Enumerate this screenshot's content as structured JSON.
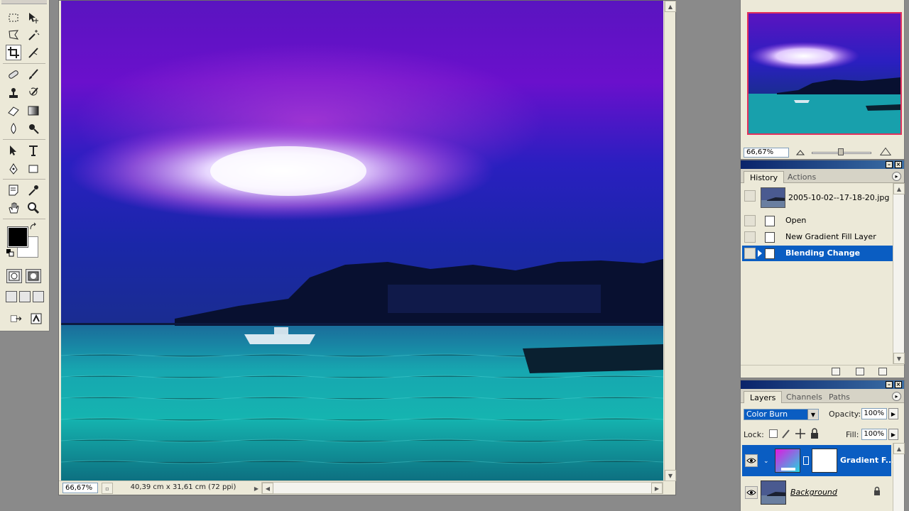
{
  "document": {
    "zoom": "66,67%",
    "info": "40,39 cm x 31,61 cm (72 ppi)"
  },
  "toolbox": {
    "tools": [
      "marquee-tool",
      "move-tool",
      "lasso-tool",
      "magic-wand-tool",
      "crop-tool",
      "slice-tool",
      "healing-brush-tool",
      "brush-tool",
      "clone-stamp-tool",
      "history-brush-tool",
      "eraser-tool",
      "gradient-tool",
      "blur-tool",
      "dodge-tool",
      "path-selection-tool",
      "type-tool",
      "pen-tool",
      "shape-tool",
      "notes-tool",
      "eyedropper-tool",
      "hand-tool",
      "zoom-tool"
    ],
    "foreground_color": "#000000",
    "background_color": "#ffffff"
  },
  "navigator": {
    "zoom": "66,67%"
  },
  "history": {
    "tabs": [
      "History",
      "Actions"
    ],
    "snapshot": "2005-10-02--17-18-20.jpg",
    "items": [
      {
        "label": "Open"
      },
      {
        "label": "New Gradient Fill Layer"
      },
      {
        "label": "Blending Change"
      }
    ]
  },
  "layers": {
    "tabs": [
      "Layers",
      "Channels",
      "Paths"
    ],
    "blend_mode": "Color Burn",
    "opacity_label": "Opacity:",
    "opacity": "100%",
    "lock_label": "Lock:",
    "fill_label": "Fill:",
    "fill": "100%",
    "items": [
      {
        "name": "Gradient F..."
      },
      {
        "name": "Background"
      }
    ]
  },
  "colors": {
    "selection": "#0a5dc2",
    "panel_bg": "#ece9d8",
    "titlebar": "#0a246a",
    "nav_frame": "#e2315b"
  }
}
